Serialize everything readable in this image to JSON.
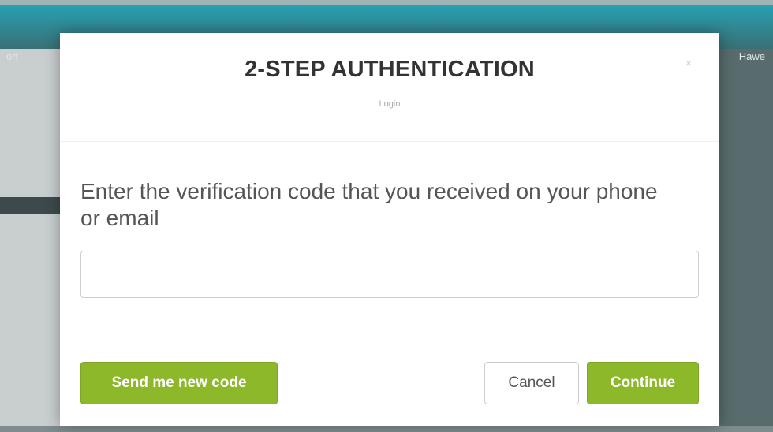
{
  "background": {
    "left_text": "ort",
    "right_text": "Hawe",
    "colors": {
      "topbar": "#24a7b8",
      "overlay": "#8a9a9c"
    }
  },
  "modal": {
    "title": "2-STEP AUTHENTICATION",
    "subtitle": "Login",
    "close_icon": "close-icon",
    "close_glyph": "×",
    "prompt": "Enter the verification code that you received on your phone or email",
    "code_input": {
      "value": "",
      "placeholder": ""
    },
    "buttons": {
      "send_new_code": "Send me new code",
      "cancel": "Cancel",
      "continue": "Continue"
    },
    "accent_color": "#8cb82a"
  }
}
